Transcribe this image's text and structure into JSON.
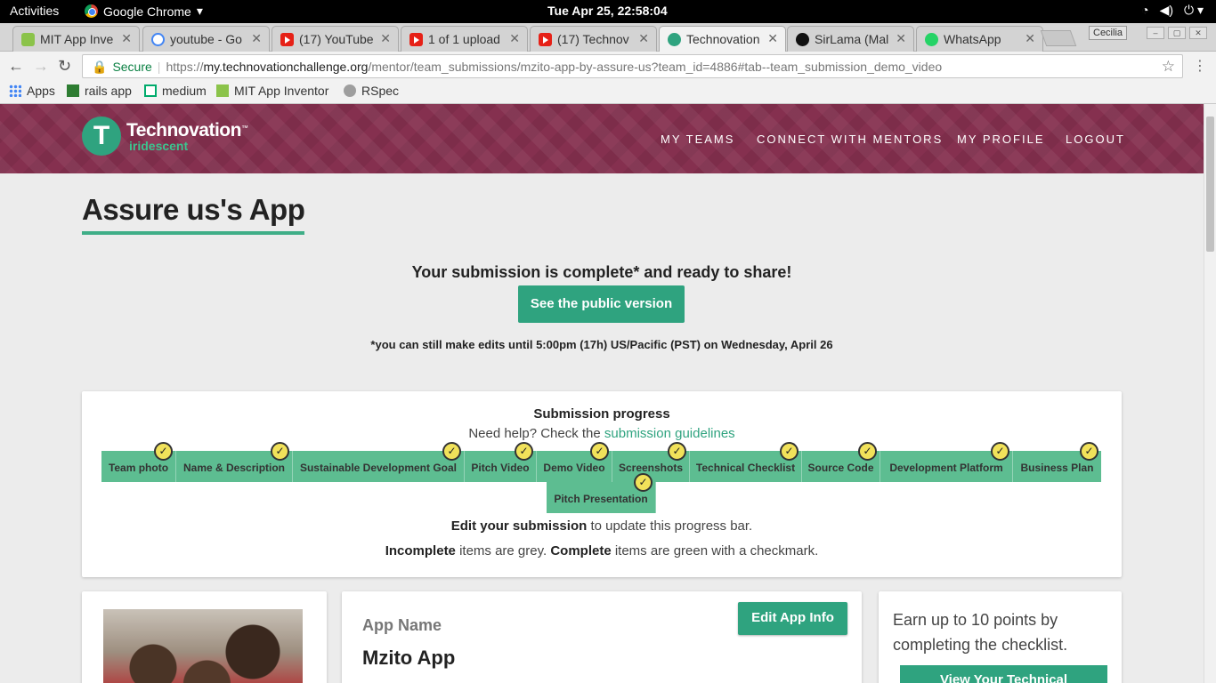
{
  "system_bar": {
    "activities": "Activities",
    "app_name": "Google Chrome",
    "app_menu_arrow": "▾",
    "clock": "Tue Apr 25, 22:58:04",
    "icons": [
      "wifi-icon",
      "volume-icon",
      "power-icon"
    ]
  },
  "tabs": [
    {
      "title": "MIT App Inve",
      "icon": "app-inventor-icon",
      "active": false
    },
    {
      "title": "youtube - Go",
      "icon": "google-icon",
      "active": false
    },
    {
      "title": "(17) YouTube",
      "icon": "youtube-icon",
      "active": false
    },
    {
      "title": "1 of 1 upload",
      "icon": "youtube-icon",
      "active": false
    },
    {
      "title": "(17) Technov",
      "icon": "youtube-icon",
      "active": false
    },
    {
      "title": "Technovation",
      "icon": "technovation-icon",
      "active": true
    },
    {
      "title": "SirLama (Mal",
      "icon": "github-icon",
      "active": false
    },
    {
      "title": "WhatsApp",
      "icon": "whatsapp-icon",
      "active": false
    }
  ],
  "profile_name": "Cecilia",
  "address_bar": {
    "secure_label": "Secure",
    "url_scheme": "https://",
    "url_host": "my.technovationchallenge.org",
    "url_path": "/mentor/team_submissions/mzito-app-by-assure-us?team_id=4886#tab--team_submission_demo_video"
  },
  "bookmarks": [
    {
      "label": "Apps",
      "icon": "apps-grid-icon"
    },
    {
      "label": "rails app",
      "icon": "rails-icon"
    },
    {
      "label": "medium",
      "icon": "medium-icon"
    },
    {
      "label": "MIT App Inventor",
      "icon": "app-inventor-icon"
    },
    {
      "label": "RSpec",
      "icon": "rspec-icon"
    }
  ],
  "site": {
    "logo_name": "Technovation",
    "logo_tm": "™",
    "logo_sub": "iridescent",
    "logo_mark": "T",
    "nav": [
      "MY TEAMS",
      "CONNECT WITH MENTORS",
      "MY PROFILE",
      "LOGOUT"
    ],
    "brand_color": "#2fa37f",
    "header_color": "#85304f"
  },
  "page": {
    "title": "Assure us's App",
    "complete_message": "Your submission is complete* and ready to share!",
    "public_button": "See the public version",
    "edit_note": "*you can still make edits until 5:00pm (17h) US/Pacific (PST) on Wednesday, April 26"
  },
  "progress": {
    "title": "Submission progress",
    "help_prefix": "Need help? Check the",
    "help_link": "submission guidelines",
    "check_mark": "✓",
    "steps": [
      {
        "label": "Team photo",
        "complete": true
      },
      {
        "label": "Name & Description",
        "complete": true
      },
      {
        "label": "Sustainable Development Goal",
        "complete": true
      },
      {
        "label": "Pitch Video",
        "complete": true
      },
      {
        "label": "Demo Video",
        "complete": true
      },
      {
        "label": "Screenshots",
        "complete": true
      },
      {
        "label": "Technical Checklist",
        "complete": true
      },
      {
        "label": "Source Code",
        "complete": true
      },
      {
        "label": "Development Platform",
        "complete": true
      },
      {
        "label": "Business Plan",
        "complete": true
      },
      {
        "label": "Pitch Presentation",
        "complete": true
      }
    ],
    "line1_bold": "Edit your submission",
    "line1_rest": " to update this progress bar.",
    "line2_bold1": "Incomplete",
    "line2_mid": " items are grey. ",
    "line2_bold2": "Complete",
    "line2_rest": " items are green with a checkmark."
  },
  "app_info": {
    "label": "App Name",
    "name": "Mzito App",
    "edit_button": "Edit App Info"
  },
  "points": {
    "text": "Earn up to 10 points by completing the checklist.",
    "button": "View Your Technical"
  }
}
